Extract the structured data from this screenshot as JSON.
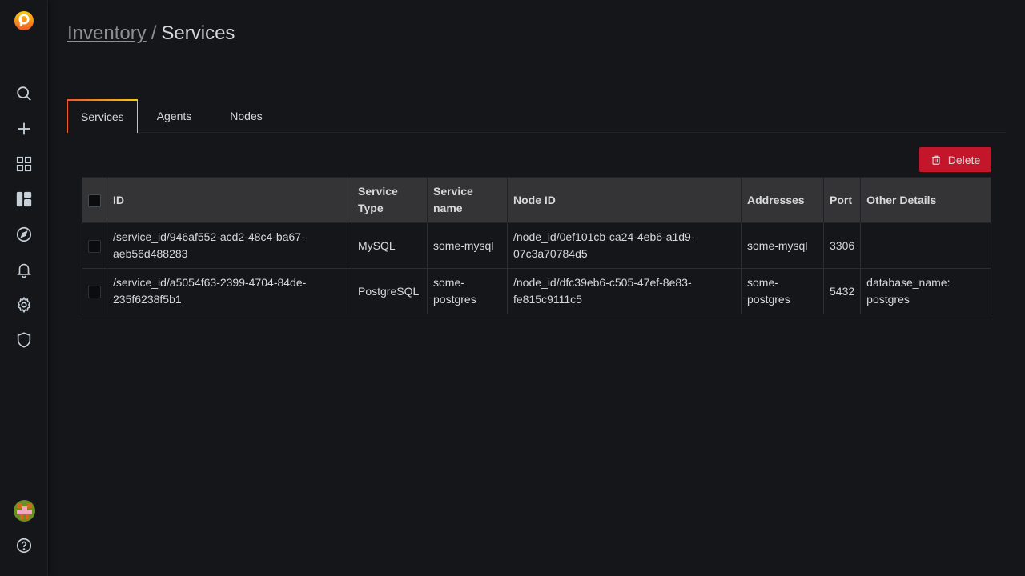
{
  "sidebar": {
    "items": [
      {
        "name": "search"
      },
      {
        "name": "create"
      },
      {
        "name": "dashboards"
      },
      {
        "name": "pmm-dashboards"
      },
      {
        "name": "explore"
      },
      {
        "name": "alerting"
      },
      {
        "name": "configuration"
      },
      {
        "name": "server-admin"
      }
    ],
    "accent": "#f05a28"
  },
  "breadcrumb": {
    "parent": "Inventory",
    "separator": "/",
    "current": "Services"
  },
  "tabs": [
    {
      "label": "Services",
      "active": true
    },
    {
      "label": "Agents",
      "active": false
    },
    {
      "label": "Nodes",
      "active": false
    }
  ],
  "toolbar": {
    "delete_label": "Delete",
    "delete_color": "#c4162a"
  },
  "table": {
    "headers": {
      "id": "ID",
      "service_type": "Service Type",
      "service_name": "Service name",
      "node_id": "Node ID",
      "addresses": "Addresses",
      "port": "Port",
      "other_details": "Other Details"
    },
    "rows": [
      {
        "id": "/service_id/946af552-acd2-48c4-ba67-aeb56d488283",
        "service_type": "MySQL",
        "service_name": "some-mysql",
        "node_id": "/node_id/0ef101cb-ca24-4eb6-a1d9-07c3a70784d5",
        "addresses": "some-mysql",
        "port": "3306",
        "other_details": ""
      },
      {
        "id": "/service_id/a5054f63-2399-4704-84de-235f6238f5b1",
        "service_type": "PostgreSQL",
        "service_name": "some-postgres",
        "node_id": "/node_id/dfc39eb6-c505-47ef-8e83-fe815c9111c5",
        "addresses": "some-postgres",
        "port": "5432",
        "other_details": "database_name: postgres"
      }
    ]
  }
}
